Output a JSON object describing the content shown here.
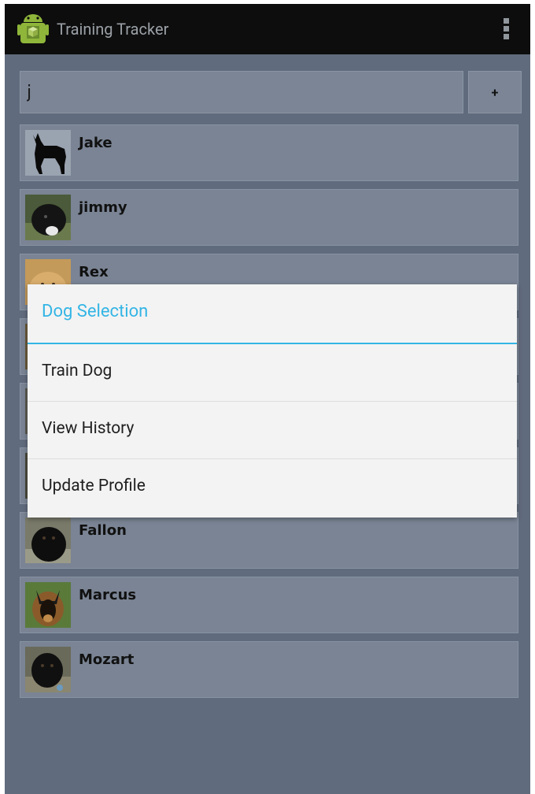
{
  "app": {
    "title": "Training Tracker",
    "icon": "android-app-icon"
  },
  "search": {
    "value": "j",
    "add_label": "+"
  },
  "dogs": [
    {
      "name": "Jake",
      "thumb": "dog-silhouette"
    },
    {
      "name": "jimmy",
      "thumb": "dog-photo-black"
    },
    {
      "name": "Rex",
      "thumb": "dog-photo-golden"
    },
    {
      "name": "",
      "thumb": "dog-photo"
    },
    {
      "name": "",
      "thumb": "dog-photo"
    },
    {
      "name": "",
      "thumb": "dog-photo"
    },
    {
      "name": "Fallon",
      "thumb": "dog-photo-black"
    },
    {
      "name": "Marcus",
      "thumb": "dog-photo-shepherd"
    },
    {
      "name": "Mozart",
      "thumb": "dog-photo-black"
    }
  ],
  "dialog": {
    "title": "Dog Selection",
    "items": [
      "Train Dog",
      "View History",
      "Update Profile"
    ]
  },
  "colors": {
    "accent": "#33b5e5",
    "background": "#606b7d",
    "actionbar": "#0d0d0d"
  }
}
